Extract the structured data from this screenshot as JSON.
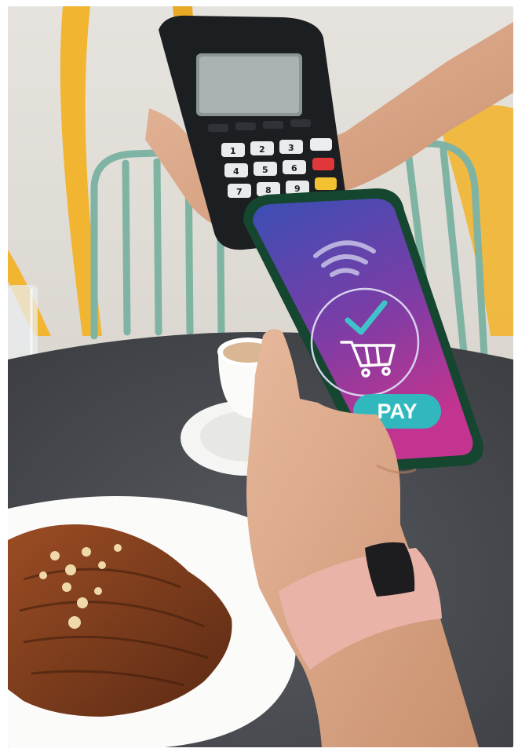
{
  "photo": {
    "subject": "contactless-payment-scene",
    "palette": {
      "background": "#d9d4cc",
      "table": "#4a4d52",
      "terminal": "#1c1f22",
      "phone_gradient_top": "#3a4fb5",
      "phone_gradient_bottom": "#c2348f",
      "pay_button": "#31b8bf",
      "check_mark": "#3fc3c9",
      "chair": "#7fb3a4",
      "chair_yellow": "#f2b531",
      "watch_band": "#e9b3a8",
      "croissant": "#7a3a1e"
    }
  },
  "terminal": {
    "keys": [
      "1",
      "2",
      "3",
      "4",
      "5",
      "6",
      "7",
      "8",
      "9"
    ]
  },
  "phone": {
    "icons": [
      "wifi-icon",
      "check-icon",
      "cart-icon"
    ],
    "pay_label": "PAY"
  }
}
